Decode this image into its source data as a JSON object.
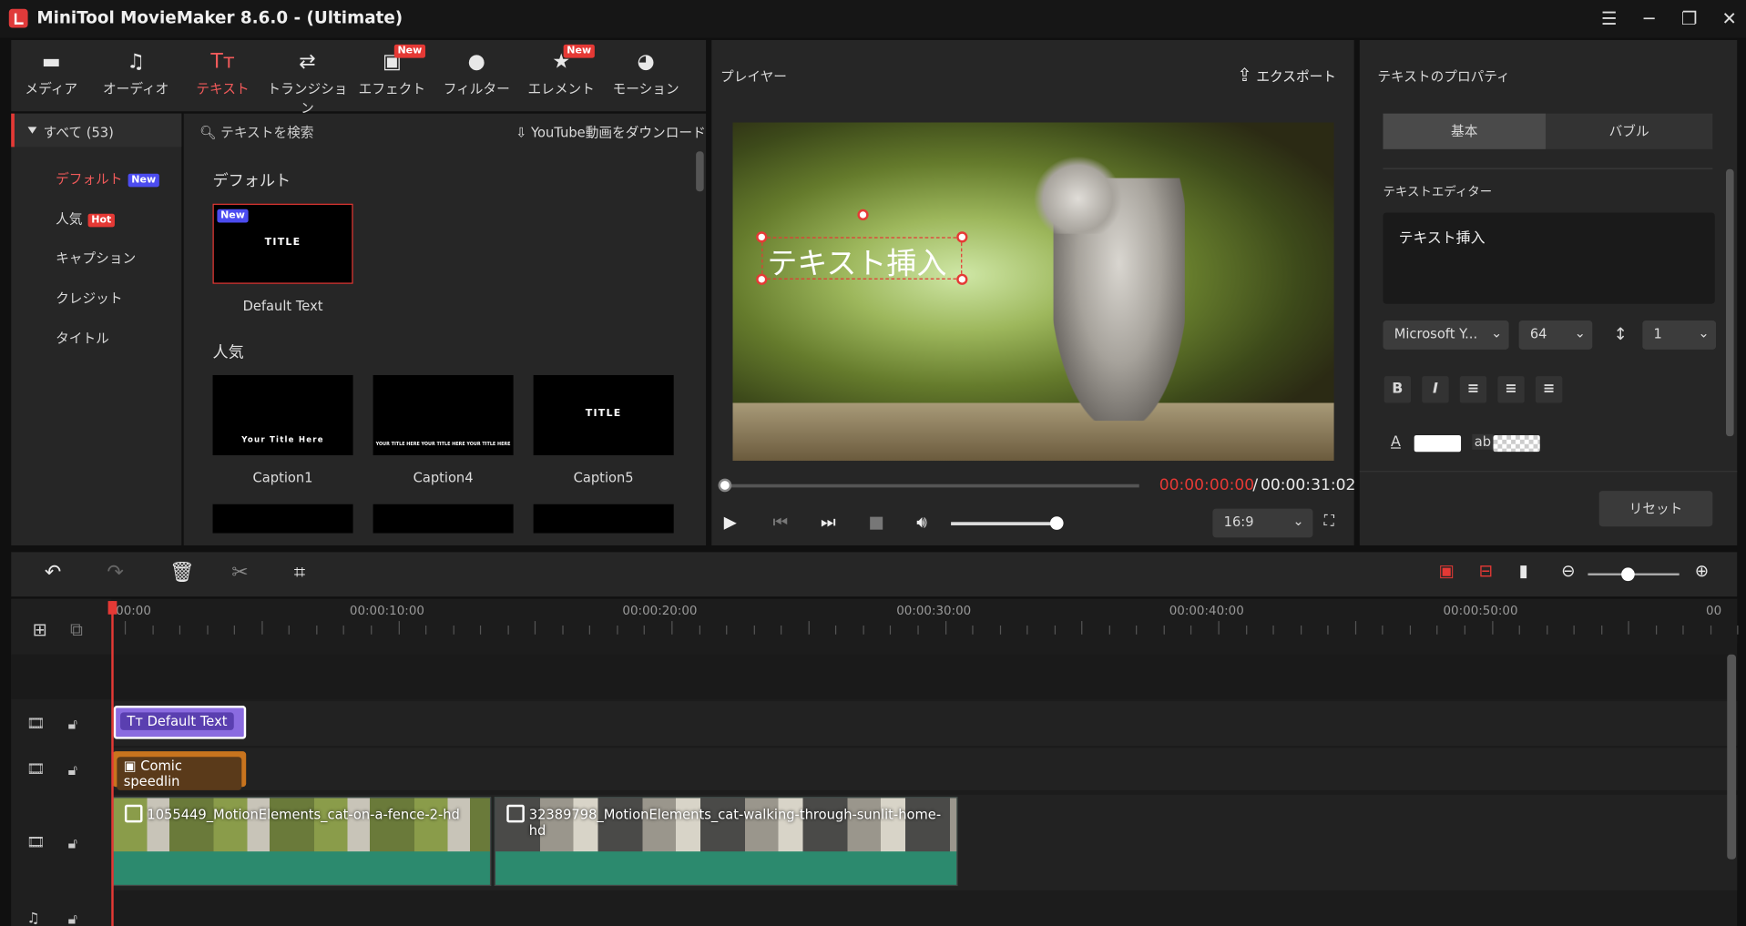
{
  "app": {
    "title": "MiniTool MovieMaker 8.6.0 - (Ultimate)"
  },
  "nav": {
    "tabs": [
      {
        "label": "メディア",
        "icon": "folder-icon"
      },
      {
        "label": "オーディオ",
        "icon": "music-note-icon"
      },
      {
        "label": "テキスト",
        "icon": "text-icon",
        "active": true
      },
      {
        "label": "トランジション",
        "icon": "transition-arrows-icon"
      },
      {
        "label": "エフェクト",
        "icon": "effects-icon",
        "badge": "New"
      },
      {
        "label": "フィルター",
        "icon": "filter-icon"
      },
      {
        "label": "エレメント",
        "icon": "element-icon",
        "badge": "New"
      },
      {
        "label": "モーション",
        "icon": "motion-icon"
      }
    ]
  },
  "categories": {
    "all": "すべて (53)",
    "items": [
      {
        "label": "デフォルト",
        "badge": "New"
      },
      {
        "label": "人気",
        "badge": "Hot"
      },
      {
        "label": "キャプション"
      },
      {
        "label": "クレジット"
      },
      {
        "label": "タイトル"
      }
    ]
  },
  "library": {
    "search_placeholder": "テキストを検索",
    "youtube_download": "YouTube動画をダウンロード",
    "sections": [
      {
        "title": "デフォルト",
        "items": [
          {
            "caption": "Default Text",
            "thumb_text": "TITLE",
            "badge": "New"
          }
        ]
      },
      {
        "title": "人気",
        "items": [
          {
            "caption": "Caption1",
            "thumb_text": "Your Title Here"
          },
          {
            "caption": "Caption4",
            "thumb_text": "YOUR TITLE HERE YOUR TITLE HERE YOUR TITLE HERE"
          },
          {
            "caption": "Caption5",
            "thumb_text": "TITLE"
          }
        ]
      }
    ]
  },
  "player": {
    "label": "プレイヤー",
    "export_label": "エクスポート",
    "overlay_text": "テキスト挿入",
    "timecode_current": "00:00:00:00",
    "timecode_separator": "/",
    "timecode_total": "00:00:31:02",
    "aspect_ratio": "16:9",
    "volume_fraction": 0.9,
    "progress_fraction": 0.0
  },
  "properties": {
    "title": "テキストのプロパティ",
    "tabs": [
      "基本",
      "バブル"
    ],
    "text_editor_label": "テキストエディター",
    "text_value": "テキスト挿入",
    "font": "Microsoft Y...",
    "font_size": "64",
    "line_spacing": "1",
    "format_buttons": [
      "B",
      "I"
    ],
    "color_label": "A",
    "bg_label": "ab",
    "reset_label": "リセット"
  },
  "timeline": {
    "ruler_labels": [
      "00:00",
      "00:00:10:00",
      "00:00:20:00",
      "00:00:30:00",
      "00:00:40:00",
      "00:00:50:00",
      "00"
    ],
    "text_clip": "Default Text",
    "effect_clip": "Comic speedlin",
    "video_clips": [
      "1055449_MotionElements_cat-on-a-fence-2-hd",
      "32389798_MotionElements_cat-walking-through-sunlit-home-hd"
    ]
  },
  "colors": {
    "accent": "#e53935",
    "text_clip": "#7b5ad6",
    "effect_clip": "#c8741e",
    "video_clip": "#2c8a6e",
    "panel": "#262626"
  }
}
